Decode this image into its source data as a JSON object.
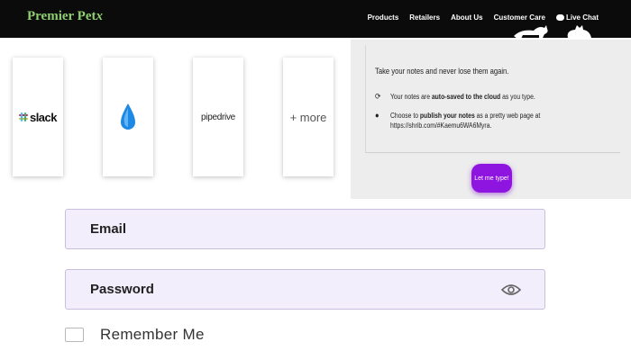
{
  "nav": {
    "brand": "Premier Pet",
    "brand_suffix": "x",
    "links": [
      "Products",
      "Retailers",
      "About Us",
      "Customer Care"
    ],
    "live_chat": "Live Chat"
  },
  "integrations": {
    "cards": [
      {
        "label": "slack",
        "icon": "slack-logo"
      },
      {
        "label": "",
        "icon": "blue-drop-logo"
      },
      {
        "label": "pipedrive",
        "icon": "pipedrive-logo"
      },
      {
        "label": "+ more",
        "icon": "more"
      }
    ]
  },
  "notes": {
    "intro": "Take your notes and never lose them again.",
    "bullet1": {
      "icon": "sync-icon",
      "pre": "Your notes are ",
      "bold": "auto-saved to the cloud",
      "post": " as you type."
    },
    "bullet2": {
      "icon": "globe-icon",
      "pre": "Choose to ",
      "bold": "publish your notes",
      "post": " as a pretty web page at",
      "line2": "https://shrib.com/#Kaemu6WA6Myra."
    },
    "button_label": "Let me type!",
    "button_color": "#8e14e0"
  },
  "form": {
    "email_placeholder": "Email",
    "password_placeholder": "Password",
    "remember_label": "Remember Me",
    "field_bg": "#f3eefc"
  }
}
